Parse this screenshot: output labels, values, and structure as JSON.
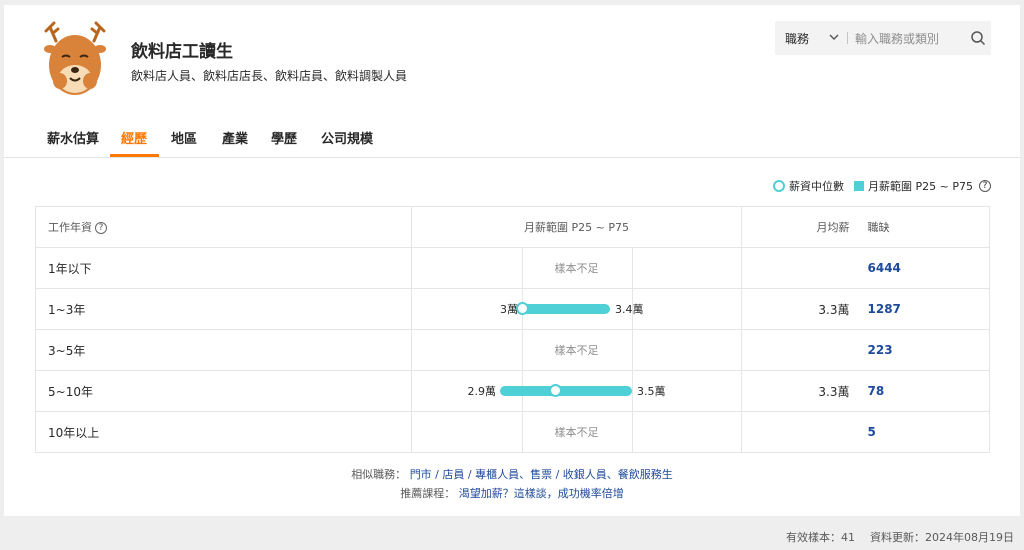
{
  "header": {
    "title": "飲料店工讀生",
    "subtitle": "飲料店人員、飲料店店長、飲料店員、飲料調製人員"
  },
  "search": {
    "category": "職務",
    "placeholder": "輸入職務或類別"
  },
  "tabs": [
    {
      "label": "薪水估算",
      "active": false
    },
    {
      "label": "經歷",
      "active": true
    },
    {
      "label": "地區",
      "active": false
    },
    {
      "label": "產業",
      "active": false
    },
    {
      "label": "學歷",
      "active": false
    },
    {
      "label": "公司規模",
      "active": false
    }
  ],
  "legend": {
    "median_label": "薪資中位數",
    "range_label": "月薪範圍 P25 ~ P75"
  },
  "table": {
    "headers": {
      "experience": "工作年資",
      "range": "月薪範圍 P25 ~ P75",
      "avg": "月均薪",
      "openings": "職缺"
    },
    "rows": [
      {
        "experience": "1年以下",
        "na_text": "樣本不足",
        "p25": null,
        "median": null,
        "p75": null,
        "p25_label": "",
        "p75_label": "",
        "avg": "",
        "openings": "6444"
      },
      {
        "experience": "1~3年",
        "na_text": "",
        "p25": 3.0,
        "median": 3.0,
        "p75": 3.4,
        "p25_label": "3萬",
        "p75_label": "3.4萬",
        "avg": "3.3萬",
        "openings": "1287"
      },
      {
        "experience": "3~5年",
        "na_text": "樣本不足",
        "p25": null,
        "median": null,
        "p75": null,
        "p25_label": "",
        "p75_label": "",
        "avg": "",
        "openings": "223"
      },
      {
        "experience": "5~10年",
        "na_text": "",
        "p25": 2.9,
        "median": 3.15,
        "p75": 3.5,
        "p25_label": "2.9萬",
        "p75_label": "3.5萬",
        "avg": "3.3萬",
        "openings": "78"
      },
      {
        "experience": "10年以上",
        "na_text": "樣本不足",
        "p25": null,
        "median": null,
        "p75": null,
        "p25_label": "",
        "p75_label": "",
        "avg": "",
        "openings": "5"
      }
    ],
    "scale": {
      "min": 2.5,
      "max": 4.0,
      "grid": [
        3.0,
        3.5
      ]
    }
  },
  "footer": {
    "similar_label": "相似職務：",
    "similar_links": "門市 / 店員 / 專櫃人員、售票 / 收銀人員、餐飲服務生",
    "course_label": "推薦課程：",
    "course_link": "渴望加薪？這樣談，成功機率倍增"
  },
  "meta": {
    "sample_text": "有效樣本：41",
    "updated_text": "資料更新：2024年08月19日",
    "help": "?"
  },
  "colors": {
    "accent": "#ff7800",
    "bar": "#4fcfd6",
    "link": "#1e4a9c"
  }
}
